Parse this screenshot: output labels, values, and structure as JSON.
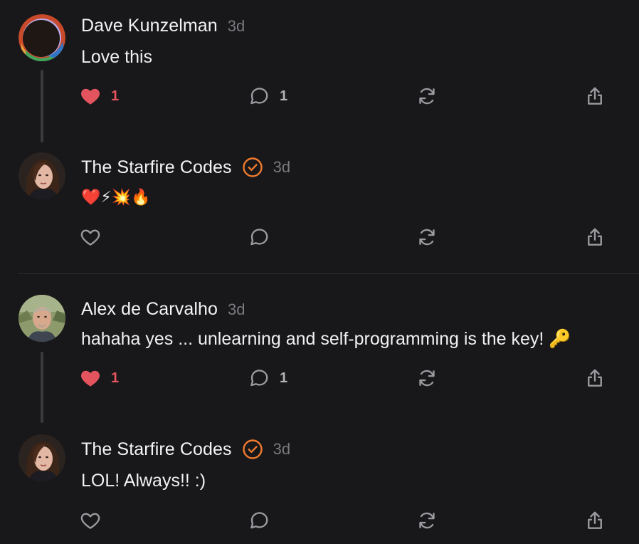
{
  "colors": {
    "background": "#18181a",
    "liked": "#e4545e",
    "verified_badge": "#ef7a2e",
    "icon": "#9a9a9f",
    "timestamp": "#7a7a7f"
  },
  "comments": [
    {
      "author": "Dave Kunzelman",
      "verified": false,
      "time": "3d",
      "text": "Love this",
      "liked": true,
      "like_count": "1",
      "reply_count": "1"
    },
    {
      "author": "The Starfire Codes",
      "verified": true,
      "time": "3d",
      "text": "❤️⚡💥🔥",
      "liked": false,
      "like_count": "",
      "reply_count": ""
    },
    {
      "author": "Alex de Carvalho",
      "verified": false,
      "time": "3d",
      "text": "hahaha yes ... unlearning and self-programming is the key! 🔑",
      "liked": true,
      "like_count": "1",
      "reply_count": "1"
    },
    {
      "author": "The Starfire Codes",
      "verified": true,
      "time": "3d",
      "text": "LOL! Always!! :)",
      "liked": false,
      "like_count": "",
      "reply_count": ""
    }
  ],
  "icons": {
    "like": "heart-icon",
    "reply": "comment-icon",
    "restack": "repost-icon",
    "share": "share-icon",
    "verified": "verified-badge-icon"
  }
}
